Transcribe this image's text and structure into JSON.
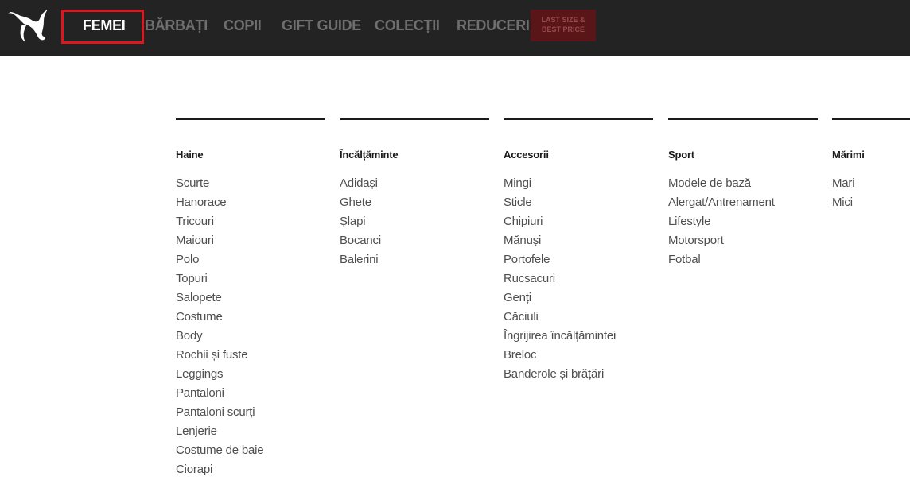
{
  "header": {
    "logo_icon": "puma-cat-icon",
    "nav": [
      {
        "label": "FEMEI",
        "active": true
      },
      {
        "label": "BĂRBAȚI",
        "active": false
      },
      {
        "label": "COPII",
        "active": false
      },
      {
        "label": "GIFT GUIDE",
        "active": false
      },
      {
        "label": "COLECȚII",
        "active": false
      },
      {
        "label": "REDUCERI",
        "active": false
      }
    ],
    "promo": {
      "line1": "LAST SIZE &",
      "line2": "BEST PRICE"
    }
  },
  "colors": {
    "topbar": "#232323",
    "active_highlight": "#e0161e",
    "promo_bg": "#5a1518"
  },
  "menu": {
    "columns": [
      {
        "heading": "Haine",
        "items": [
          "Scurte",
          "Hanorace",
          "Tricouri",
          "Maiouri",
          "Polo",
          "Topuri",
          "Salopete",
          "Costume",
          "Body",
          "Rochii și fuste",
          "Leggings",
          "Pantaloni",
          "Pantaloni scurți",
          "Lenjerie",
          "Costume de baie",
          "Ciorapi"
        ]
      },
      {
        "heading": "Încălțăminte",
        "items": [
          "Adidași",
          "Ghete",
          "Șlapi",
          "Bocanci",
          "Balerini"
        ]
      },
      {
        "heading": "Accesorii",
        "items": [
          "Mingi",
          "Sticle",
          "Chipiuri",
          "Mănuși",
          "Portofele",
          "Rucsacuri",
          "Genți",
          "Căciuli",
          "Îngrijirea încălțămintei",
          "Breloc",
          "Banderole și brățări"
        ]
      },
      {
        "heading": "Sport",
        "items": [
          "Modele de bază",
          "Alergat/Antrenament",
          "Lifestyle",
          "Motorsport",
          "Fotbal"
        ]
      },
      {
        "heading": "Mărimi",
        "items": [
          "Mari",
          "Mici"
        ]
      }
    ]
  }
}
